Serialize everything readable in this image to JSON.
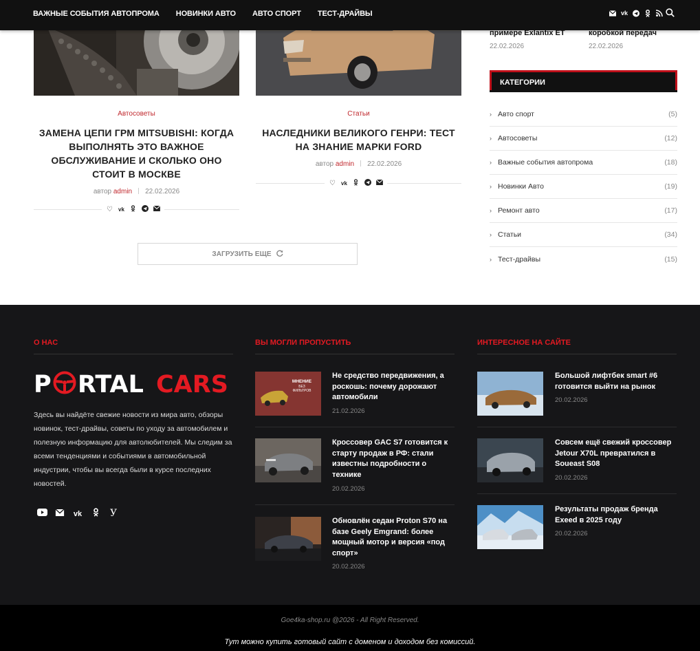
{
  "nav": {
    "items": [
      "ВАЖНЫЕ СОБЫТИЯ АВТОПРОМА",
      "НОВИНКИ АВТО",
      "АВТО СПОРТ",
      "ТЕСТ-ДРАЙВЫ"
    ],
    "social_icons": [
      "mail-icon",
      "vk-icon",
      "telegram-icon",
      "odnoklassniki-icon",
      "rss-icon"
    ],
    "search_icon": "search-icon"
  },
  "posts": [
    {
      "category": "Автосоветы",
      "title": "ЗАМЕНА ЦЕПИ ГРМ MITSUBISHI: КОГДА ВЫПОЛНЯТЬ ЭТО ВАЖНОЕ ОБСЛУЖИВАНИЕ И СКОЛЬКО ОНО СТОИТ В МОСКВЕ",
      "author_prefix": "автор",
      "author": "admin",
      "date": "22.02.2026"
    },
    {
      "category": "Статьи",
      "title": "НАСЛЕДНИКИ ВЕЛИКОГО ГЕНРИ: ТЕСТ НА ЗНАНИЕ МАРКИ FORD",
      "author_prefix": "автор",
      "author": "admin",
      "date": "22.02.2026"
    }
  ],
  "share_icons": [
    "heart-icon",
    "vk-icon",
    "odnoklassniki-icon",
    "telegram-icon",
    "mail-icon"
  ],
  "load_more": "ЗАГРУЗИТЬ ЕЩЕ",
  "sidebar": {
    "mini_posts": [
      {
        "title": "примере Exlantix ET",
        "date": "22.02.2026"
      },
      {
        "title": "коробкой передач",
        "date": "22.02.2026"
      }
    ],
    "categories_title": "КАТЕГОРИИ",
    "categories": [
      {
        "name": "Авто спорт",
        "count": "(5)"
      },
      {
        "name": "Автосоветы",
        "count": "(12)"
      },
      {
        "name": "Важные события автопрома",
        "count": "(18)"
      },
      {
        "name": "Новинки Авто",
        "count": "(19)"
      },
      {
        "name": "Ремонт авто",
        "count": "(17)"
      },
      {
        "name": "Статьи",
        "count": "(34)"
      },
      {
        "name": "Тест-драйвы",
        "count": "(15)"
      }
    ]
  },
  "footer": {
    "about_title": "О НАС",
    "logo_left": "P",
    "logo_mid": "RTAL",
    "logo_right": "CARS",
    "about_text": "Здесь вы найдёте свежие новости из мира авто, обзоры новинок, тест-драйвы, советы по уходу за автомобилем и полезную информацию для автолюбителей. Мы следим за всеми тенденциями и событиями в автомобильной индустрии, чтобы вы всегда были в курсе последних новостей.",
    "social_icons": [
      "youtube-icon",
      "mail-icon",
      "vk-icon",
      "odnoklassniki-icon",
      "yandex-icon"
    ],
    "missed_title": "ВЫ МОГЛИ ПРОПУСТИТЬ",
    "missed": [
      {
        "title": "Не средство передвижения, а роскошь: почему дорожают автомобили",
        "date": "21.02.2026",
        "thumb_text": "МНЕНИЕ\nБЕЗ\nФИЛЬТРОВ"
      },
      {
        "title": "Кроссовер GAC S7 готовится к старту продаж в РФ: стали известны подробности о технике",
        "date": "20.02.2026"
      },
      {
        "title": "Обновлён седан Proton S70 на базе Geely Emgrand: более мощный мотор и версия «под спорт»",
        "date": "20.02.2026"
      }
    ],
    "interesting_title": "ИНТЕРЕСНОЕ НА САЙТЕ",
    "interesting": [
      {
        "title": "Большой лифтбек smart #6 готовится выйти на рынок",
        "date": "20.02.2026"
      },
      {
        "title": "Совсем ещё свежий кроссовер Jetour X70L превратился в Soueast S08",
        "date": "20.02.2026"
      },
      {
        "title": "Результаты продаж бренда Exeed в 2025 году",
        "date": "20.02.2026"
      }
    ],
    "copyright": "Goe4ka-shop.ru @2026 - All Right Reserved.",
    "sale": "Тут можно купить готовый сайт с доменом и доходом без комиссий."
  },
  "colors": {
    "accent": "#e31a22",
    "category": "#c0282d",
    "dark": "#161618"
  }
}
